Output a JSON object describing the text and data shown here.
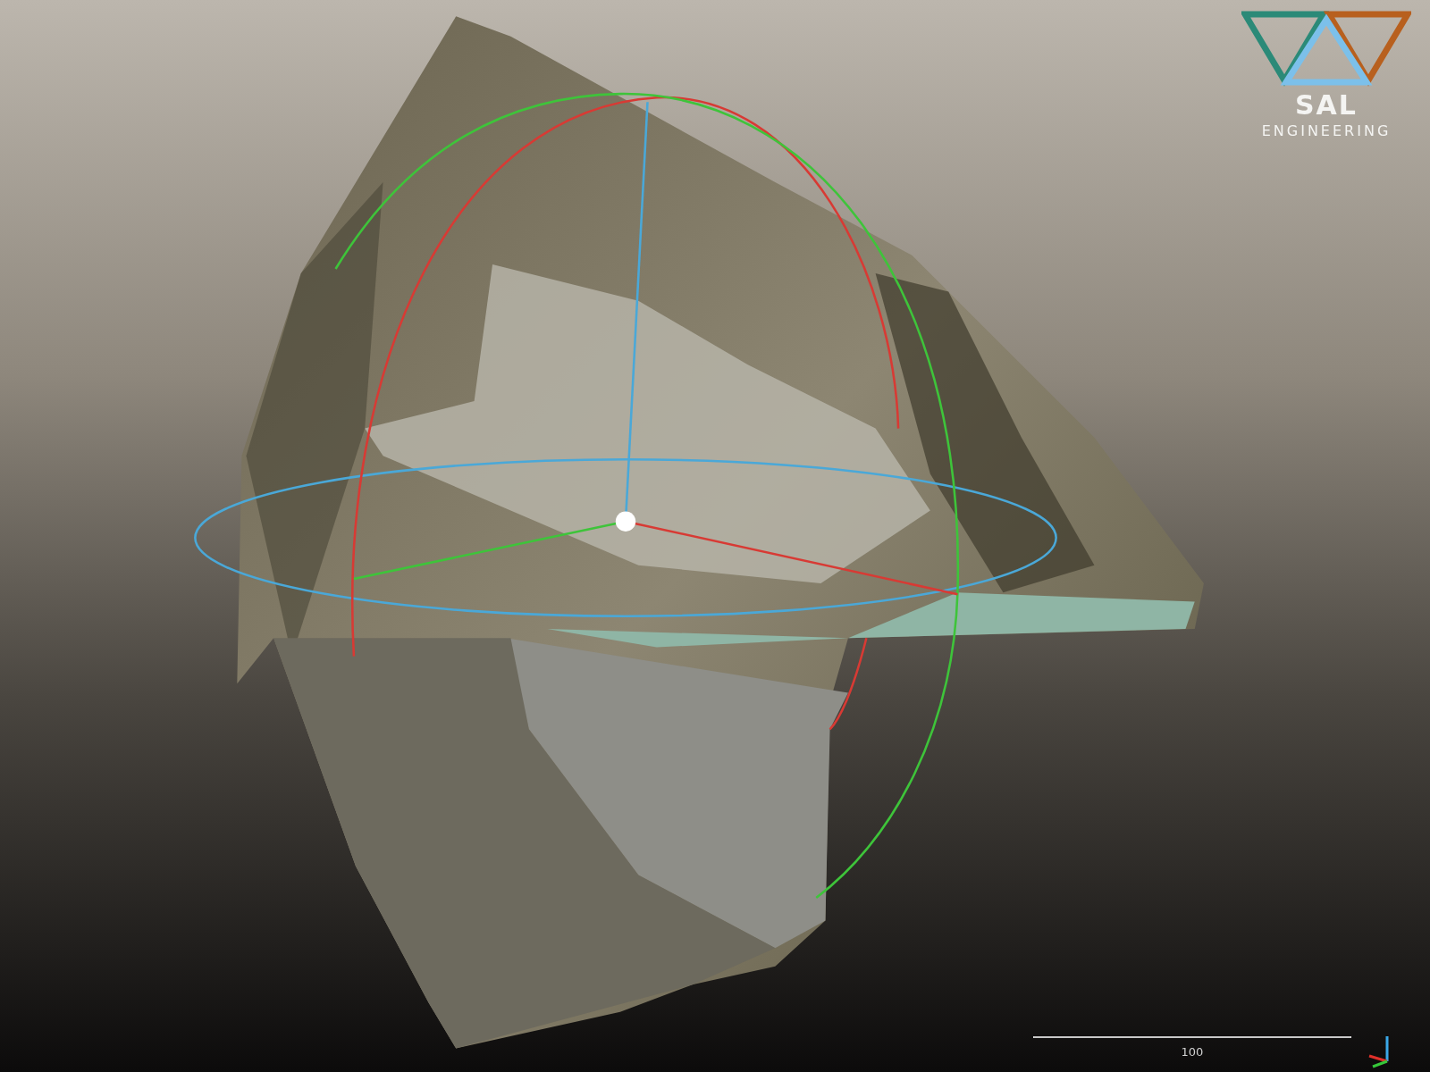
{
  "logo": {
    "title": "SAL",
    "subtitle": "ENGINEERING"
  },
  "scale_bar": {
    "label": "100"
  }
}
